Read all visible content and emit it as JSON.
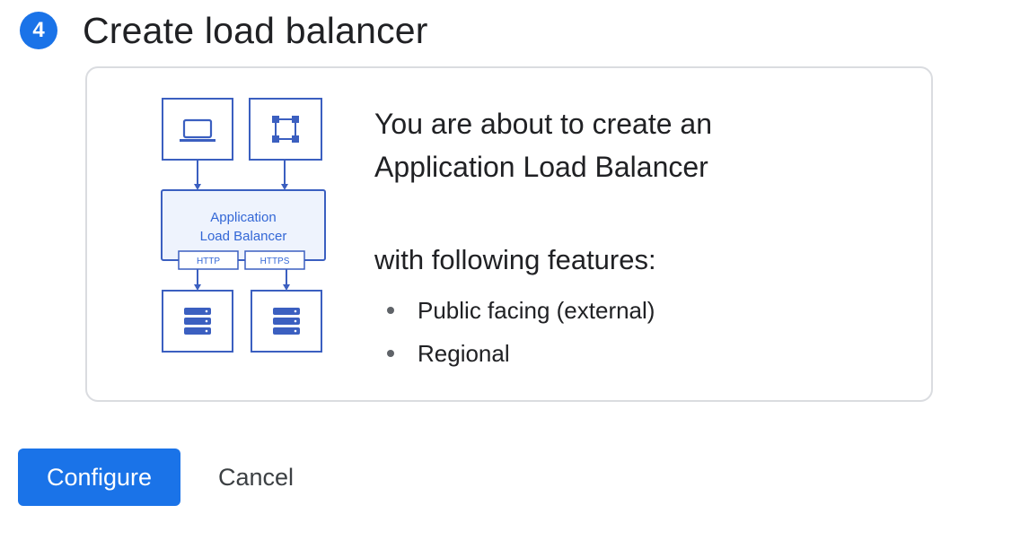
{
  "step": {
    "number": "4",
    "title": "Create load balancer"
  },
  "card": {
    "headline_line1": "You are about to create an",
    "headline_line2": "Application Load Balancer",
    "subhead": "with following features:",
    "features": [
      "Public facing (external)",
      "Regional"
    ],
    "diagram": {
      "lb_line1": "Application",
      "lb_line2": "Load Balancer",
      "protocol_1": "HTTP",
      "protocol_2": "HTTPS",
      "icons": [
        "laptop-icon",
        "network-node-icon",
        "database-icon",
        "database-icon"
      ],
      "stroke_color": "#3b5fc0",
      "fill_color": "#eef3fd",
      "text_color": "#3367d6"
    }
  },
  "actions": {
    "primary_label": "Configure",
    "secondary_label": "Cancel"
  },
  "colors": {
    "accent": "#1a73e8",
    "border": "#dadce0",
    "text": "#202124"
  }
}
